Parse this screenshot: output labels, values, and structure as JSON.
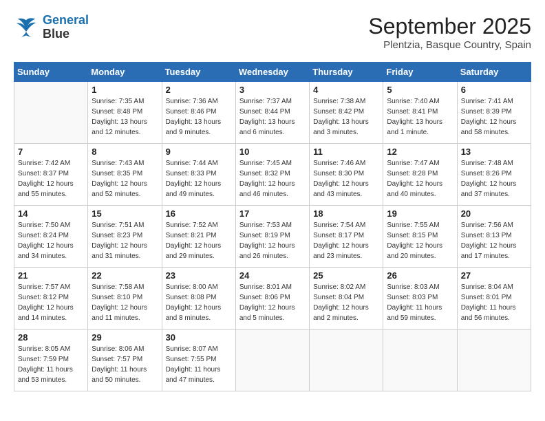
{
  "header": {
    "logo_line1": "General",
    "logo_line2": "Blue",
    "month": "September 2025",
    "location": "Plentzia, Basque Country, Spain"
  },
  "weekdays": [
    "Sunday",
    "Monday",
    "Tuesday",
    "Wednesday",
    "Thursday",
    "Friday",
    "Saturday"
  ],
  "weeks": [
    [
      {
        "day": "",
        "info": ""
      },
      {
        "day": "1",
        "info": "Sunrise: 7:35 AM\nSunset: 8:48 PM\nDaylight: 13 hours\nand 12 minutes."
      },
      {
        "day": "2",
        "info": "Sunrise: 7:36 AM\nSunset: 8:46 PM\nDaylight: 13 hours\nand 9 minutes."
      },
      {
        "day": "3",
        "info": "Sunrise: 7:37 AM\nSunset: 8:44 PM\nDaylight: 13 hours\nand 6 minutes."
      },
      {
        "day": "4",
        "info": "Sunrise: 7:38 AM\nSunset: 8:42 PM\nDaylight: 13 hours\nand 3 minutes."
      },
      {
        "day": "5",
        "info": "Sunrise: 7:40 AM\nSunset: 8:41 PM\nDaylight: 13 hours\nand 1 minute."
      },
      {
        "day": "6",
        "info": "Sunrise: 7:41 AM\nSunset: 8:39 PM\nDaylight: 12 hours\nand 58 minutes."
      }
    ],
    [
      {
        "day": "7",
        "info": "Sunrise: 7:42 AM\nSunset: 8:37 PM\nDaylight: 12 hours\nand 55 minutes."
      },
      {
        "day": "8",
        "info": "Sunrise: 7:43 AM\nSunset: 8:35 PM\nDaylight: 12 hours\nand 52 minutes."
      },
      {
        "day": "9",
        "info": "Sunrise: 7:44 AM\nSunset: 8:33 PM\nDaylight: 12 hours\nand 49 minutes."
      },
      {
        "day": "10",
        "info": "Sunrise: 7:45 AM\nSunset: 8:32 PM\nDaylight: 12 hours\nand 46 minutes."
      },
      {
        "day": "11",
        "info": "Sunrise: 7:46 AM\nSunset: 8:30 PM\nDaylight: 12 hours\nand 43 minutes."
      },
      {
        "day": "12",
        "info": "Sunrise: 7:47 AM\nSunset: 8:28 PM\nDaylight: 12 hours\nand 40 minutes."
      },
      {
        "day": "13",
        "info": "Sunrise: 7:48 AM\nSunset: 8:26 PM\nDaylight: 12 hours\nand 37 minutes."
      }
    ],
    [
      {
        "day": "14",
        "info": "Sunrise: 7:50 AM\nSunset: 8:24 PM\nDaylight: 12 hours\nand 34 minutes."
      },
      {
        "day": "15",
        "info": "Sunrise: 7:51 AM\nSunset: 8:23 PM\nDaylight: 12 hours\nand 31 minutes."
      },
      {
        "day": "16",
        "info": "Sunrise: 7:52 AM\nSunset: 8:21 PM\nDaylight: 12 hours\nand 29 minutes."
      },
      {
        "day": "17",
        "info": "Sunrise: 7:53 AM\nSunset: 8:19 PM\nDaylight: 12 hours\nand 26 minutes."
      },
      {
        "day": "18",
        "info": "Sunrise: 7:54 AM\nSunset: 8:17 PM\nDaylight: 12 hours\nand 23 minutes."
      },
      {
        "day": "19",
        "info": "Sunrise: 7:55 AM\nSunset: 8:15 PM\nDaylight: 12 hours\nand 20 minutes."
      },
      {
        "day": "20",
        "info": "Sunrise: 7:56 AM\nSunset: 8:13 PM\nDaylight: 12 hours\nand 17 minutes."
      }
    ],
    [
      {
        "day": "21",
        "info": "Sunrise: 7:57 AM\nSunset: 8:12 PM\nDaylight: 12 hours\nand 14 minutes."
      },
      {
        "day": "22",
        "info": "Sunrise: 7:58 AM\nSunset: 8:10 PM\nDaylight: 12 hours\nand 11 minutes."
      },
      {
        "day": "23",
        "info": "Sunrise: 8:00 AM\nSunset: 8:08 PM\nDaylight: 12 hours\nand 8 minutes."
      },
      {
        "day": "24",
        "info": "Sunrise: 8:01 AM\nSunset: 8:06 PM\nDaylight: 12 hours\nand 5 minutes."
      },
      {
        "day": "25",
        "info": "Sunrise: 8:02 AM\nSunset: 8:04 PM\nDaylight: 12 hours\nand 2 minutes."
      },
      {
        "day": "26",
        "info": "Sunrise: 8:03 AM\nSunset: 8:03 PM\nDaylight: 11 hours\nand 59 minutes."
      },
      {
        "day": "27",
        "info": "Sunrise: 8:04 AM\nSunset: 8:01 PM\nDaylight: 11 hours\nand 56 minutes."
      }
    ],
    [
      {
        "day": "28",
        "info": "Sunrise: 8:05 AM\nSunset: 7:59 PM\nDaylight: 11 hours\nand 53 minutes."
      },
      {
        "day": "29",
        "info": "Sunrise: 8:06 AM\nSunset: 7:57 PM\nDaylight: 11 hours\nand 50 minutes."
      },
      {
        "day": "30",
        "info": "Sunrise: 8:07 AM\nSunset: 7:55 PM\nDaylight: 11 hours\nand 47 minutes."
      },
      {
        "day": "",
        "info": ""
      },
      {
        "day": "",
        "info": ""
      },
      {
        "day": "",
        "info": ""
      },
      {
        "day": "",
        "info": ""
      }
    ]
  ]
}
